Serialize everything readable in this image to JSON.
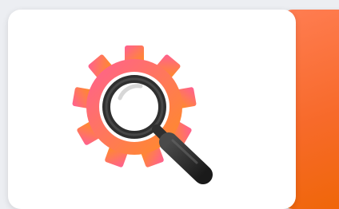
{
  "cards": {
    "main": {
      "icon": "search-settings-icon"
    },
    "accent": {
      "color": "#f76a2a"
    }
  },
  "colors": {
    "page_bg": "#eceef2",
    "gear_gradient_start": "#ff6f8f",
    "gear_gradient_end": "#ff8a2a",
    "magnifier": "#2b2b2b",
    "accent": "#ef6607"
  }
}
